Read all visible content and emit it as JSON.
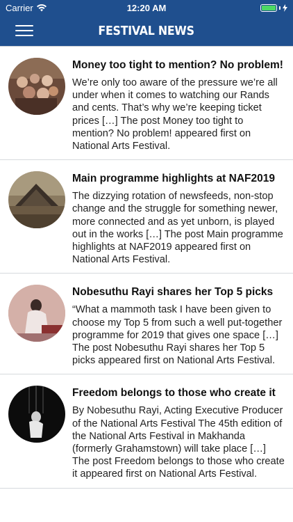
{
  "status": {
    "carrier": "Carrier",
    "time": "12:20 AM"
  },
  "nav": {
    "title": "FESTIVAL NEWS",
    "menu_icon": "hamburger-menu-icon"
  },
  "colors": {
    "nav_background": "#1f4f8e",
    "battery_fill": "#4cd964"
  },
  "articles": [
    {
      "title": "Money too tight to mention? No problem!",
      "excerpt": "We’re only too aware of the pressure we’re all under when it comes to watching our Rands and cents. That’s why we’re keeping ticket prices […]  The post Money too tight to mention? No problem! appeared first on National Arts Festival."
    },
    {
      "title": "Main programme highlights at NAF2019",
      "excerpt": "The dizzying rotation of newsfeeds, non-stop change and the struggle for something newer, more connected and as yet unborn, is played out in the works […]  The post Main programme highlights at NAF2019 appeared first on National Arts Festival."
    },
    {
      "title": "Nobesuthu Rayi shares her Top 5 picks",
      "excerpt": "“What a mammoth task I have been given to choose my Top 5 from such a well put-together programme for 2019 that gives one space […]  The post Nobesuthu Rayi shares her Top 5 picks appeared first on National Arts Festival."
    },
    {
      "title": "Freedom belongs to those who create it",
      "excerpt": "By Nobesuthu Rayi, Acting Executive Producer of the National Arts Festival The 45th edition of the National Arts Festival in Makhanda (formerly Grahamstown) will take place […]  The post Freedom belongs to those who create it appeared first on National Arts Festival."
    }
  ]
}
